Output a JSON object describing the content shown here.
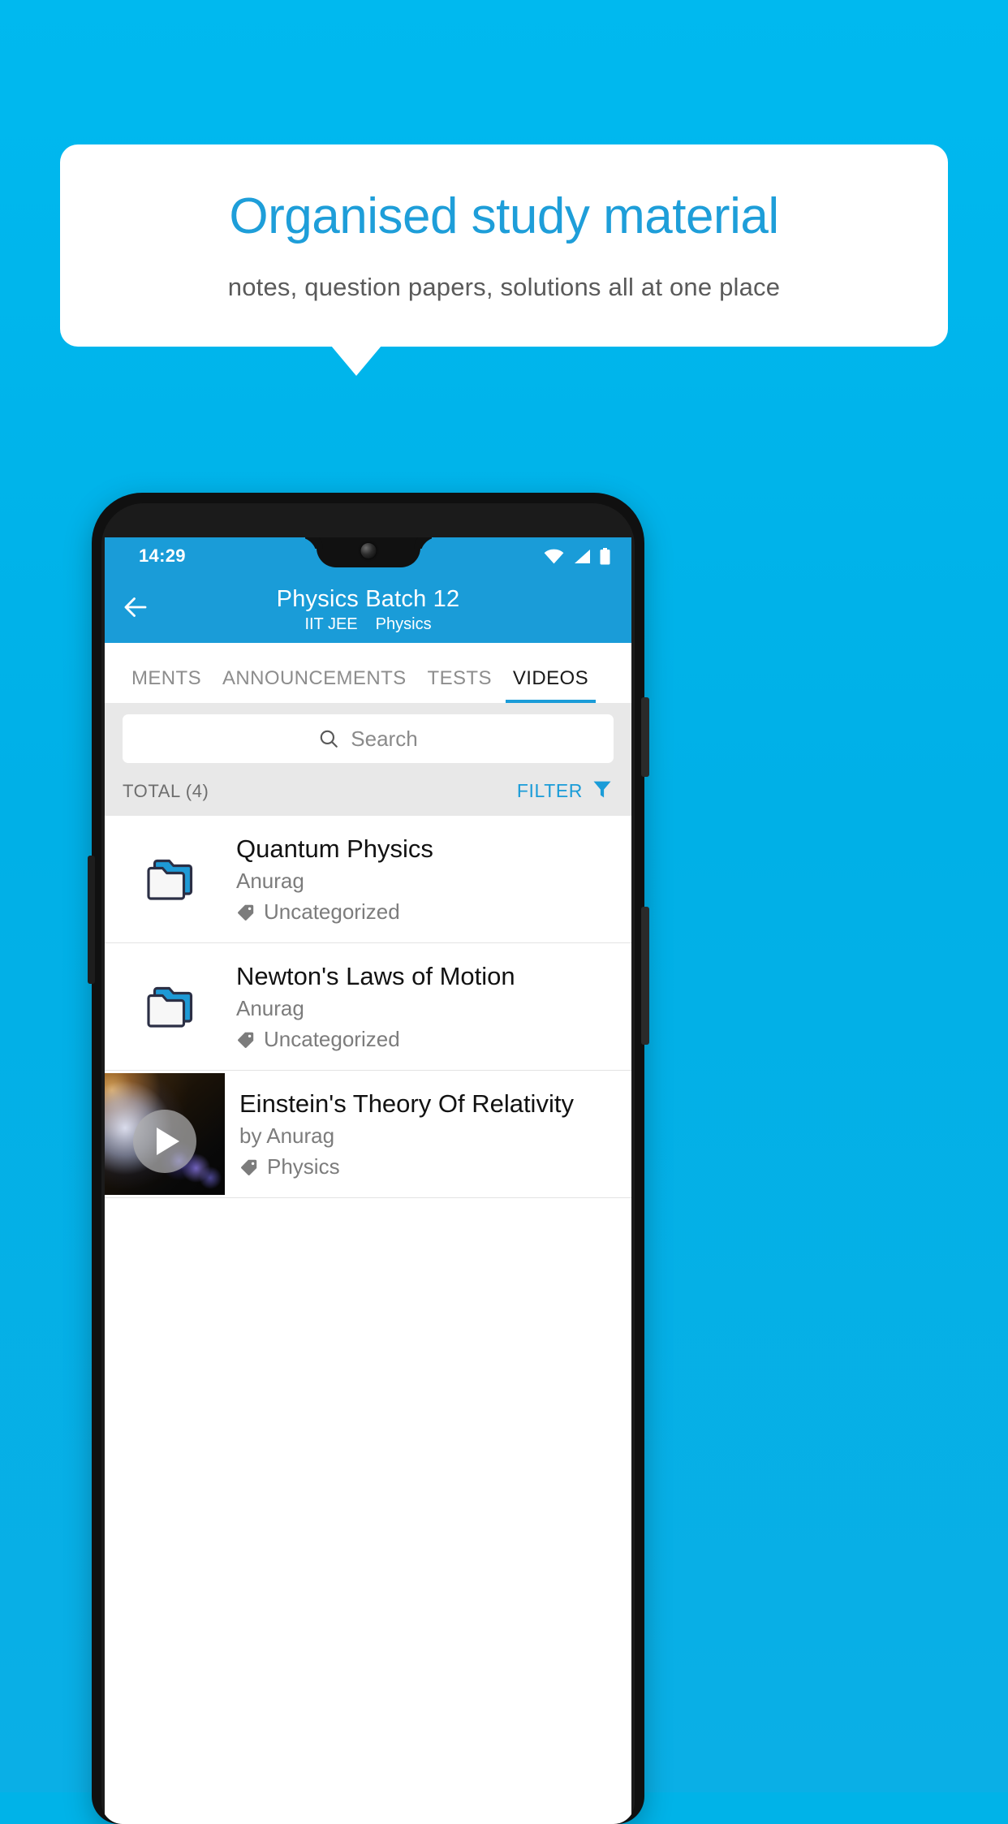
{
  "background": {
    "color": "#00b0e7"
  },
  "callout": {
    "headline": "Organised study material",
    "subhead": "notes, question papers, solutions all at one place",
    "headline_color": "#1e9ed9",
    "subhead_color": "#5a5a5a"
  },
  "phone": {
    "statusbar": {
      "time": "14:29",
      "icons": [
        "wifi-icon",
        "signal-icon",
        "battery-icon"
      ],
      "background": "#1a9cd8"
    },
    "appbar": {
      "back_icon": "back-arrow-icon",
      "title": "Physics Batch 12",
      "subtitle_exam": "IIT JEE",
      "subtitle_subject": "Physics",
      "background": "#1a9cd8"
    },
    "tabs": [
      {
        "label": "MENTS",
        "active": false
      },
      {
        "label": "ANNOUNCEMENTS",
        "active": false
      },
      {
        "label": "TESTS",
        "active": false
      },
      {
        "label": "VIDEOS",
        "active": true
      }
    ],
    "tab_indicator_color": "#1a9cd8",
    "search": {
      "placeholder": "Search",
      "icon": "search-icon",
      "value": ""
    },
    "toolbar": {
      "total_label": "TOTAL (4)",
      "filter_label": "FILTER",
      "filter_icon": "funnel-icon",
      "filter_color": "#1a9cd8"
    },
    "list": [
      {
        "type": "folder",
        "icon": "folder-icon",
        "title": "Quantum Physics",
        "author": "Anurag",
        "tag": "Uncategorized",
        "tag_icon": "tag-icon"
      },
      {
        "type": "folder",
        "icon": "folder-icon",
        "title": "Newton's Laws of Motion",
        "author": "Anurag",
        "tag": "Uncategorized",
        "tag_icon": "tag-icon"
      },
      {
        "type": "video",
        "icon": "video-thumbnail",
        "play_icon": "play-icon",
        "title": "Einstein's Theory Of Relativity",
        "author": "by Anurag",
        "tag": "Physics",
        "tag_icon": "tag-icon"
      }
    ]
  }
}
